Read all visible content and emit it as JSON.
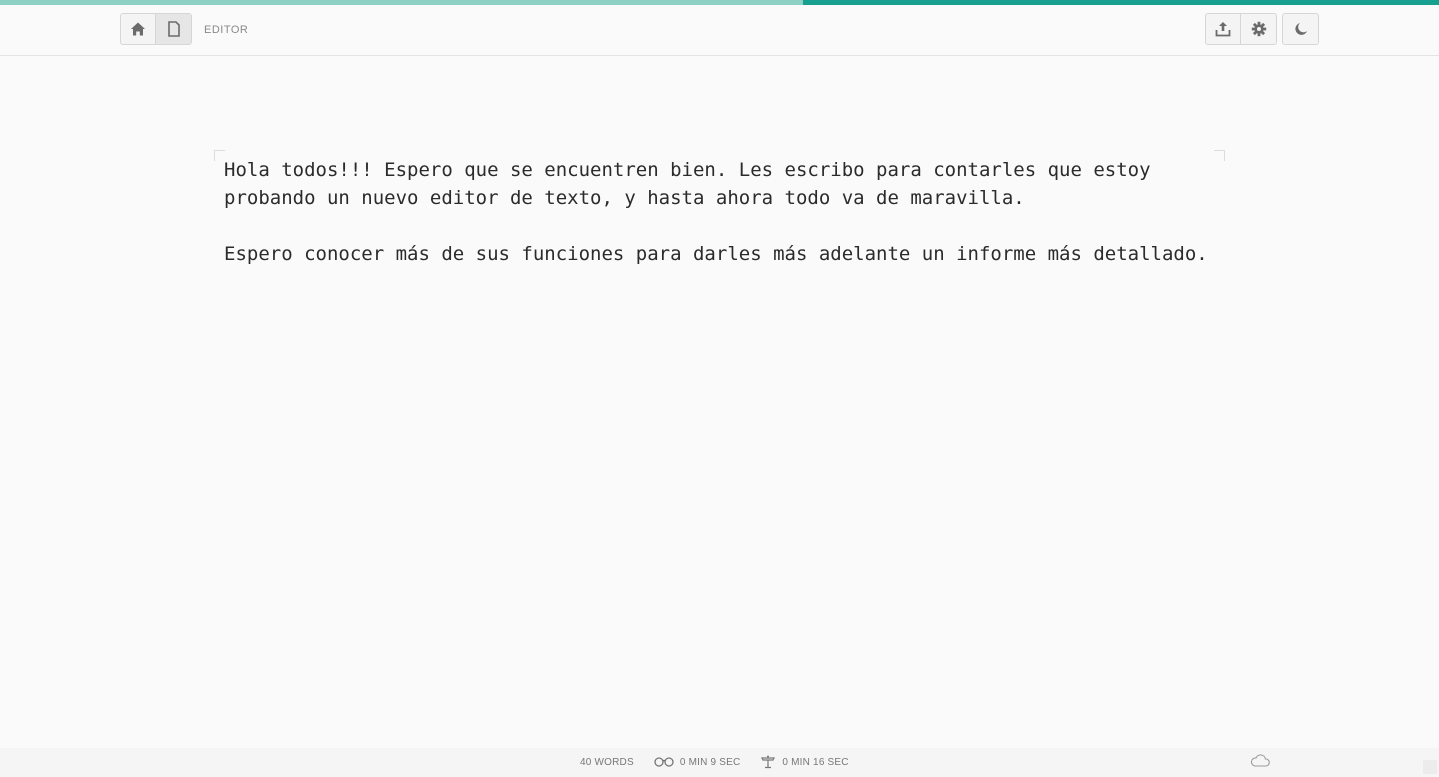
{
  "progress": {
    "value_percent": 44.2,
    "color_track": "#8fd0c5",
    "color_fill": "#17a08f"
  },
  "header": {
    "breadcrumb": "EDITOR",
    "left_buttons": [
      {
        "icon": "home-icon",
        "active": false
      },
      {
        "icon": "document-icon",
        "active": true
      }
    ],
    "right_buttons": [
      {
        "icon": "upload-icon"
      },
      {
        "icon": "gear-icon"
      }
    ],
    "theme_button": {
      "icon": "moon-icon"
    }
  },
  "editor": {
    "paragraphs": [
      "Hola todos!!! Espero que se encuentren bien. Les escribo para contarles que estoy probando un nuevo editor de texto, y hasta ahora todo va de maravilla.",
      "Espero conocer más de sus funciones para darles más adelante un informe más detallado."
    ]
  },
  "footer": {
    "words": "40 WORDS",
    "reading_time": "0 MIN 9 SEC",
    "speaking_time": "0 MIN 16 SEC",
    "cloud_icon": "cloud-icon"
  }
}
